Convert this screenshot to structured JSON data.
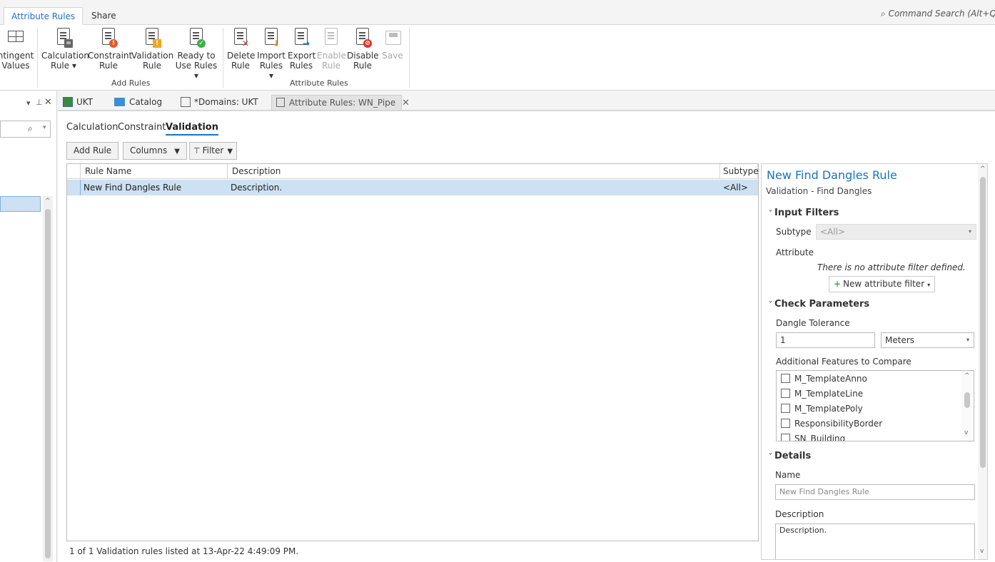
{
  "top_tabs": {
    "attribute_rules": "Attribute Rules",
    "share": "Share"
  },
  "command_search": {
    "placeholder": "Command Search (Alt+Q)"
  },
  "ribbon": {
    "contingent": {
      "line1": "ntingent",
      "line2": "Values"
    },
    "calculation": {
      "line1": "Calculation",
      "line2": "Rule ▾"
    },
    "constraint": {
      "line1": "Constraint",
      "line2": "Rule"
    },
    "validation": {
      "line1": "Validation",
      "line2": "Rule"
    },
    "ready": {
      "line1": "Ready to",
      "line2": "Use Rules ▾"
    },
    "add_rules_group": "Add Rules",
    "delete": {
      "line1": "Delete",
      "line2": "Rule"
    },
    "import": {
      "line1": "Import",
      "line2": "Rules ▾"
    },
    "export": {
      "line1": "Export",
      "line2": "Rules"
    },
    "enable": {
      "line1": "Enable",
      "line2": "Rule"
    },
    "disable": {
      "line1": "Disable",
      "line2": "Rule"
    },
    "save": {
      "line1": "Save"
    },
    "attribute_rules_group": "Attribute Rules"
  },
  "doc_tabs": {
    "ukt": "UKT",
    "catalog": "Catalog",
    "domains": "*Domains: UKT",
    "attr_rules": "Attribute Rules: WN_Pipe"
  },
  "sub_tabs": {
    "calculation": "Calculation",
    "constraint": "Constraint",
    "validation": "Validation"
  },
  "toolbar": {
    "add_rule": "Add Rule",
    "columns": "Columns",
    "filter": "Filter"
  },
  "grid": {
    "headers": {
      "rule_name": "Rule Name",
      "description": "Description",
      "subtype": "Subtype"
    },
    "rows": [
      {
        "rule_name": "New Find Dangles Rule",
        "description": "Description.",
        "subtype": "<All>"
      }
    ]
  },
  "status": "1 of 1 Validation rules listed at 13-Apr-22 4:49:09 PM.",
  "panel": {
    "title": "New Find Dangles Rule",
    "subtitle": "Validation - Find Dangles",
    "input_filters": "Input Filters",
    "subtype_label": "Subtype",
    "subtype_value": "<All>",
    "attribute_label": "Attribute",
    "no_filter": "There is no attribute filter defined.",
    "new_filter": "New attribute filter",
    "check_params": "Check Parameters",
    "dangle_tol": "Dangle Tolerance",
    "tol_value": "1",
    "tol_unit": "Meters",
    "additional": "Additional Features to Compare",
    "features": [
      "M_TemplateAnno",
      "M_TemplateLine",
      "M_TemplatePoly",
      "ResponsibilityBorder",
      "SN_Building"
    ],
    "details": "Details",
    "name_label": "Name",
    "name_value": "New Find Dangles Rule",
    "desc_label": "Description",
    "desc_value": "Description."
  },
  "colors": {
    "accent": "#1a73c0",
    "selected_row": "#cde1f3"
  }
}
